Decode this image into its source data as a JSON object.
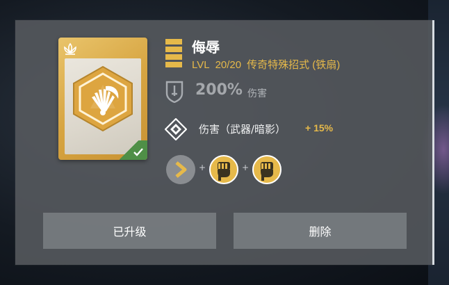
{
  "skill": {
    "name": "侮辱",
    "level_prefix": "LVL",
    "level": "20/20",
    "category": "传奇特殊招式 (铁扇)",
    "damage_value": "200%",
    "damage_label": "伤害",
    "bonus_label": "伤害（武器/暗影）",
    "bonus_value": "+ 15%",
    "combo": [
      "arrow-right-icon",
      "fist-icon",
      "fist-icon"
    ],
    "combo_plus": "+"
  },
  "buttons": {
    "upgraded_label": "已升级",
    "delete_label": "删除"
  },
  "colors": {
    "gold": "#e6b94a",
    "card_gold": "#d7a542",
    "check_green": "#4f8f47",
    "panel": "#565a5f"
  }
}
